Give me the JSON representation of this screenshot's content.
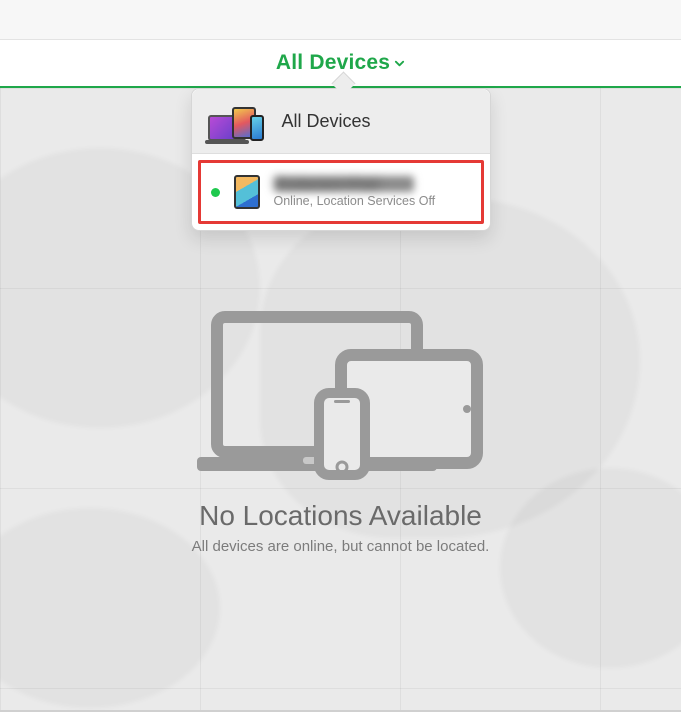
{
  "header": {
    "title": "All Devices"
  },
  "dropdown": {
    "all_label": "All Devices",
    "device": {
      "name": "Redacted iPad",
      "status": "Online, Location Services Off",
      "online": true
    }
  },
  "empty_state": {
    "title": "No Locations Available",
    "subtitle": "All devices are online, but cannot be located."
  },
  "colors": {
    "accent": "#1fa74a",
    "highlight": "#e53935"
  }
}
